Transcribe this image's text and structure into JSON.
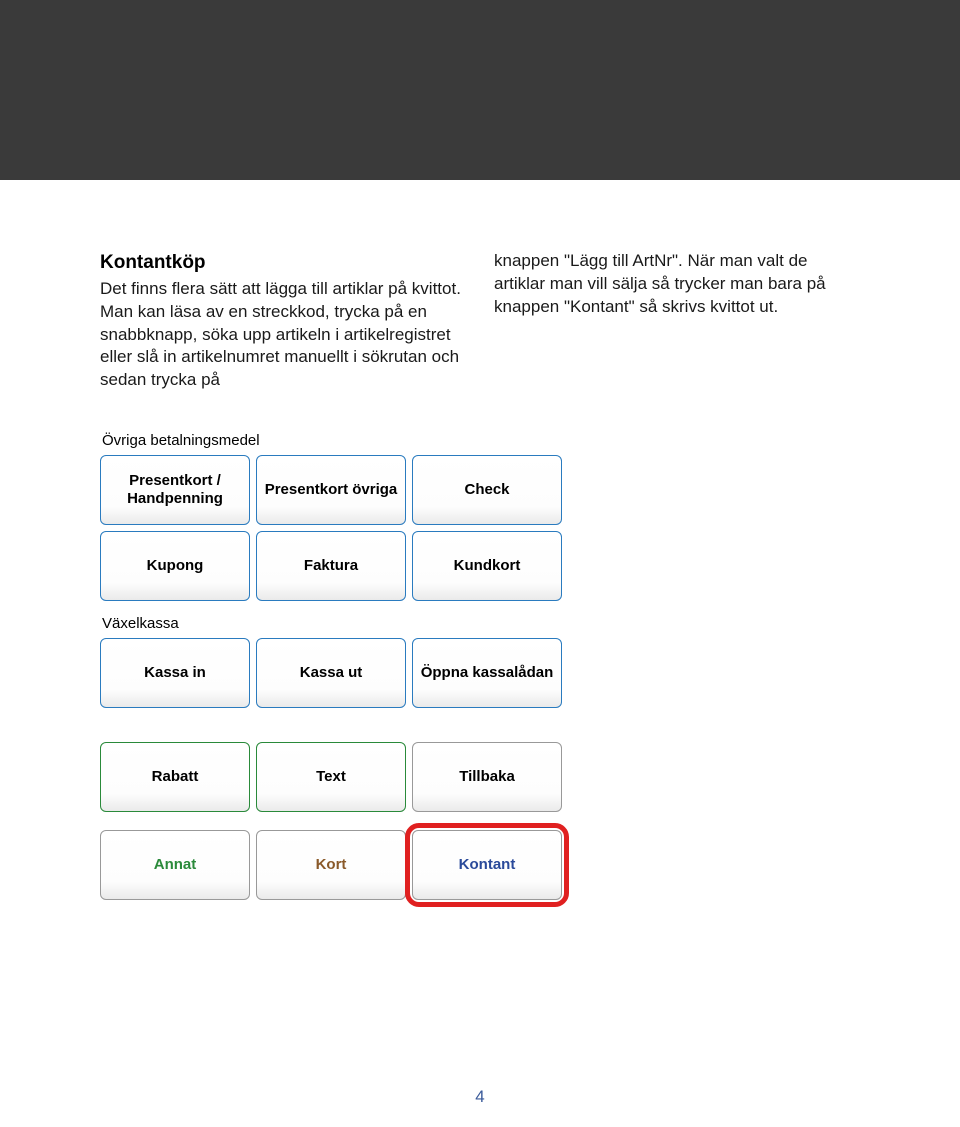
{
  "header": {},
  "article": {
    "title": "Kontantköp",
    "col1": "Det finns flera sätt att lägga till artiklar på kvittot. Man kan läsa av en streckkod, trycka på en snabbknapp, söka upp artikeln i artikelregistret eller slå in artikelnumret manuellt i sökrutan och sedan trycka på",
    "col2": "knappen \"Lägg till ArtNr\". När man valt de artiklar man vill sälja så trycker man bara på knappen \"Kontant\" så skrivs kvittot ut."
  },
  "panel": {
    "section1_label": "Övriga betalningsmedel",
    "section2_label": "Växelkassa",
    "row1": [
      "Presentkort / Handpenning",
      "Presentkort övriga",
      "Check"
    ],
    "row2": [
      "Kupong",
      "Faktura",
      "Kundkort"
    ],
    "row3": [
      "Kassa in",
      "Kassa ut",
      "Öppna kassalådan"
    ],
    "row4": [
      "Rabatt",
      "Text",
      "Tillbaka"
    ],
    "row5": [
      "Annat",
      "Kort",
      "Kontant"
    ]
  },
  "page_number": "4"
}
